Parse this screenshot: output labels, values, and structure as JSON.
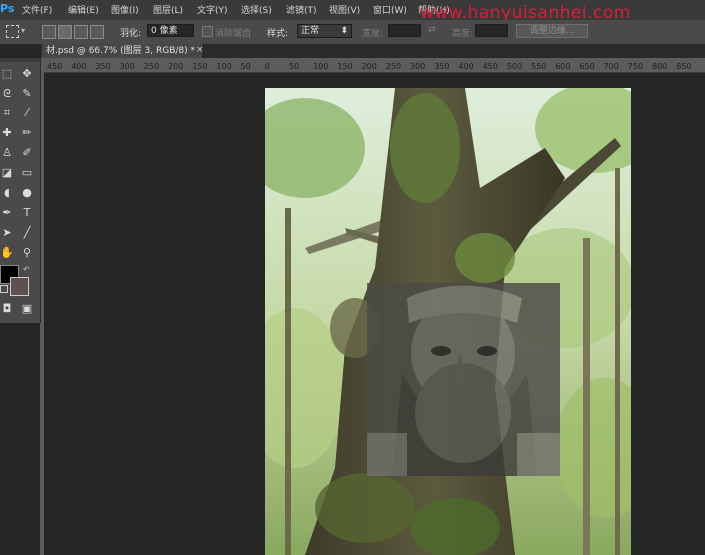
{
  "app": {
    "logo": "Ps"
  },
  "menu": [
    "文件(F)",
    "编辑(E)",
    "图像(I)",
    "图层(L)",
    "文字(Y)",
    "选择(S)",
    "滤镜(T)",
    "视图(V)",
    "窗口(W)",
    "帮助(H)"
  ],
  "watermark": "www.hanyuisanhei.com",
  "options": {
    "feather_label": "羽化:",
    "feather_value": "0 像素",
    "antialias_label": "消除锯齿",
    "style_label": "样式:",
    "style_value": "正常",
    "width_label": "宽度:",
    "height_label": "高度:",
    "refine_edge": "调整边缘..."
  },
  "document": {
    "tab_title": "材.psd @ 66.7% (图层 3, RGB/8) *",
    "close": "×"
  },
  "ruler": [
    "450",
    "400",
    "350",
    "300",
    "250",
    "200",
    "150",
    "100",
    "50",
    "0",
    "50",
    "100",
    "150",
    "200",
    "250",
    "300",
    "350",
    "400",
    "450",
    "500",
    "550",
    "600",
    "650",
    "700",
    "750",
    "800",
    "850"
  ],
  "colors": {
    "foreground": "#000000",
    "background": "#5f5050",
    "accent": "#31a8ff",
    "watermark": "#e01c3c"
  },
  "icons": [
    "marquee-icon",
    "move-icon",
    "lasso-icon",
    "quick-select-icon",
    "crop-icon",
    "eyedropper-icon",
    "healing-icon",
    "brush-icon",
    "stamp-icon",
    "history-brush-icon",
    "eraser-icon",
    "gradient-icon",
    "blur-icon",
    "dodge-icon",
    "pen-icon",
    "type-icon",
    "path-select-icon",
    "line-icon",
    "hand-icon",
    "zoom-icon",
    "quickmask-icon",
    "screen-mode-icon"
  ]
}
